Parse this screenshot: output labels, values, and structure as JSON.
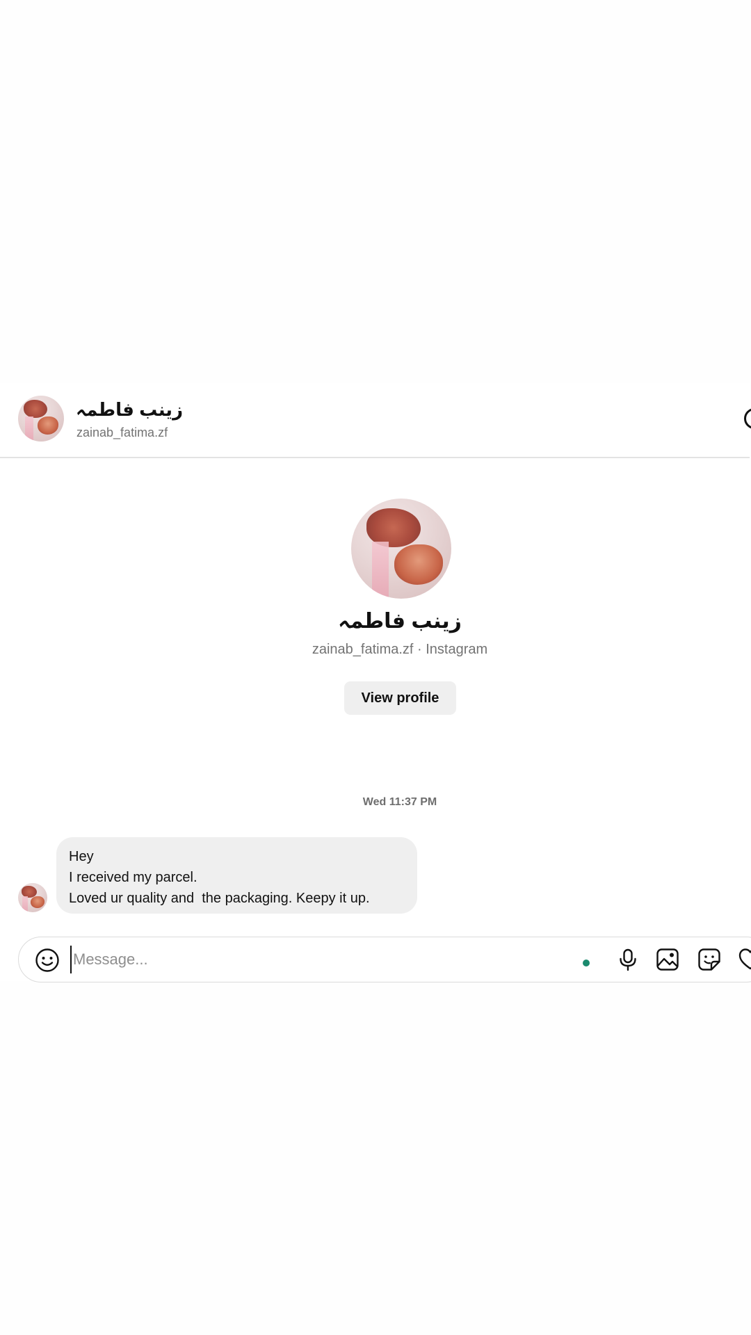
{
  "header": {
    "name": "زينب فاطمہ",
    "username": "zainab_fatima.zf"
  },
  "profile": {
    "name": "زينب فاطمہ",
    "subtitle": "zainab_fatima.zf · Instagram",
    "view_profile_label": "View profile"
  },
  "thread": {
    "timestamp": "Wed 11:37 PM",
    "messages": [
      {
        "lines": [
          "Hey",
          "I received my parcel.",
          "Loved ur quality and  the packaging. Keepy it up."
        ]
      }
    ]
  },
  "composer": {
    "placeholder": "Message...",
    "value": ""
  },
  "icons": {
    "emoji": "smiley-icon",
    "mic": "microphone-icon",
    "image": "image-icon",
    "sticker": "sticker-icon",
    "heart": "heart-icon",
    "header_right": "info-icon"
  },
  "colors": {
    "online_dot": "#1a8a6e",
    "bubble": "#efefef",
    "button": "#efefef"
  }
}
